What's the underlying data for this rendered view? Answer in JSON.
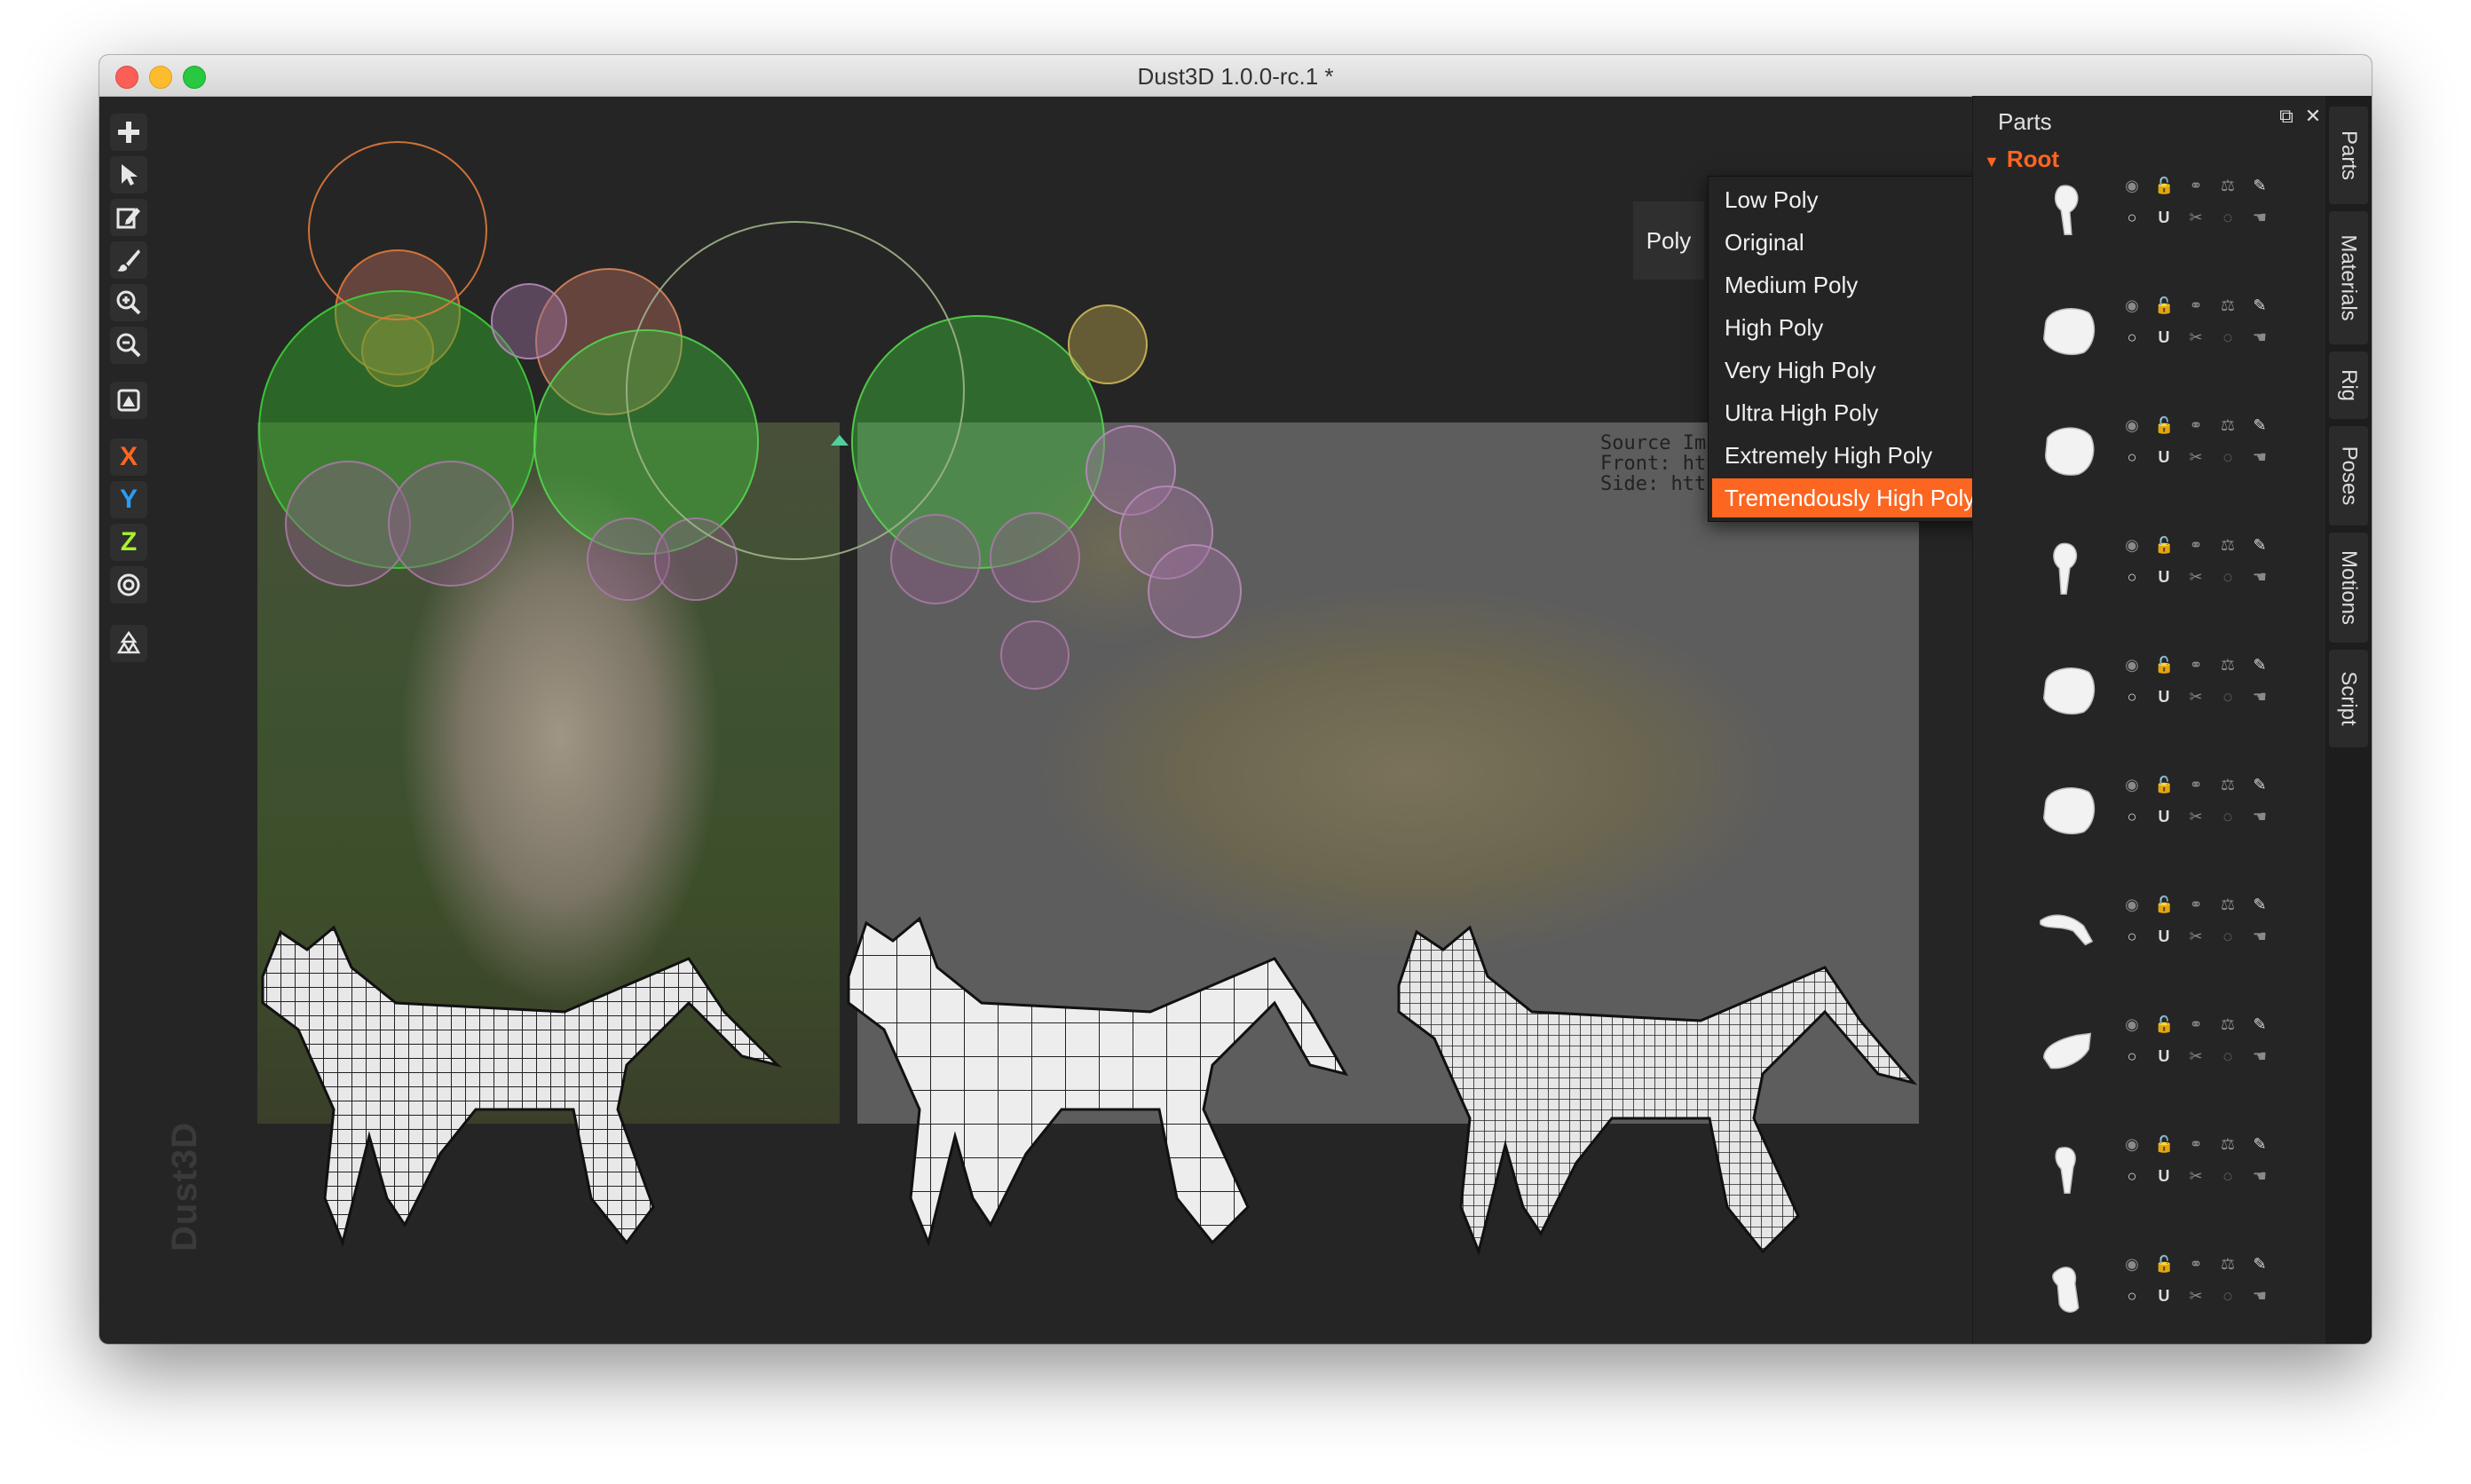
{
  "window": {
    "title": "Dust3D 1.0.0-rc.1 *"
  },
  "toolbar": {
    "items": [
      "add",
      "select",
      "edit",
      "paint",
      "zoom-in",
      "zoom-out",
      "reference",
      "axis-x",
      "axis-y",
      "axis-z",
      "radius",
      "recycle"
    ],
    "axis_x": "X",
    "axis_y": "Y",
    "axis_z": "Z"
  },
  "canvas": {
    "watermark": "Dust3D",
    "source_text": "Source Images (P\nFront: https://px\nSide: https://ch.w"
  },
  "poly_menu": {
    "button_label": "Poly",
    "options": [
      "Low Poly",
      "Original",
      "Medium Poly",
      "High Poly",
      "Very High Poly",
      "Ultra High Poly",
      "Extremely High Poly",
      "Tremendously High Poly"
    ],
    "selected": "Tremendously High Poly"
  },
  "parts_panel": {
    "title": "Parts",
    "root_label": "Root",
    "part_count": 11
  },
  "side_tabs": [
    "Parts",
    "Materials",
    "Rig",
    "Poses",
    "Motions",
    "Script"
  ],
  "colors": {
    "accent": "#fc6621",
    "axis_x": "#fc6621",
    "axis_y": "#2a9df4",
    "axis_z": "#aaf22c"
  }
}
